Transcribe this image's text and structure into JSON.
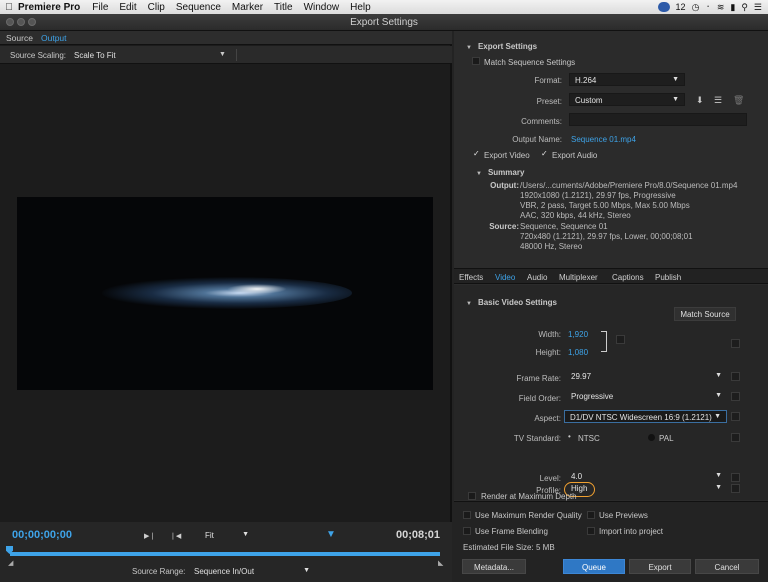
{
  "menubar": {
    "apple_icon": "apple-logo",
    "app_name": "Premiere Pro",
    "items": [
      "File",
      "Edit",
      "Clip",
      "Sequence",
      "Marker",
      "Title",
      "Window",
      "Help"
    ],
    "tray_badge_count": "12"
  },
  "window": {
    "title": "Export Settings"
  },
  "left": {
    "tabs": [
      "Source",
      "Output"
    ],
    "active_tab": "Output",
    "source_scaling_label": "Source Scaling:",
    "source_scaling_value": "Scale To Fit",
    "timecode_start": "00;00;00;00",
    "timecode_end": "00;08;01",
    "zoom_value": "Fit",
    "source_range_label": "Source Range:",
    "source_range_value": "Sequence In/Out"
  },
  "export_settings": {
    "header": "Export Settings",
    "match_sequence_label": "Match Sequence Settings",
    "format_label": "Format:",
    "format_value": "H.264",
    "preset_label": "Preset:",
    "preset_value": "Custom",
    "comments_label": "Comments:",
    "output_name_label": "Output Name:",
    "output_name_value": "Sequence 01.mp4",
    "export_video_label": "Export Video",
    "export_audio_label": "Export Audio",
    "export_video_checked": true,
    "export_audio_checked": true
  },
  "summary": {
    "header": "Summary",
    "output_label": "Output:",
    "output_lines": [
      "/Users/...cuments/Adobe/Premiere Pro/8.0/Sequence 01.mp4",
      "1920x1080 (1.2121), 29.97 fps, Progressive",
      "VBR, 2 pass, Target 5.00 Mbps, Max 5.00 Mbps",
      "AAC, 320 kbps, 44 kHz, Stereo"
    ],
    "source_label": "Source:",
    "source_lines": [
      "Sequence, Sequence 01",
      "720x480 (1.2121), 29.97 fps, Lower, 00;00;08;01",
      "48000 Hz, Stereo"
    ]
  },
  "settings_tabs": [
    "Effects",
    "Video",
    "Audio",
    "Multiplexer",
    "Captions",
    "Publish"
  ],
  "active_settings_tab": "Video",
  "video": {
    "header": "Basic Video Settings",
    "match_source_label": "Match Source",
    "width_label": "Width:",
    "width_value": "1,920",
    "height_label": "Height:",
    "height_value": "1,080",
    "frame_rate_label": "Frame Rate:",
    "frame_rate_value": "29.97",
    "field_order_label": "Field Order:",
    "field_order_value": "Progressive",
    "aspect_label": "Aspect:",
    "aspect_value": "D1/DV NTSC Widescreen 16:9 (1.2121)",
    "tv_standard_label": "TV Standard:",
    "tv_ntsc_label": "NTSC",
    "tv_pal_label": "PAL",
    "profile_label": "Profile:",
    "profile_value": "High",
    "level_label": "Level:",
    "level_value": "4.0",
    "render_max_depth_label": "Render at Maximum Depth"
  },
  "bottom": {
    "max_render_quality_label": "Use Maximum Render Quality",
    "use_previews_label": "Use Previews",
    "frame_blending_label": "Use Frame Blending",
    "import_project_label": "Import into project",
    "file_size_label": "Estimated File Size:",
    "file_size_value": "5 MB",
    "metadata_label": "Metadata...",
    "queue_label": "Queue",
    "export_label": "Export",
    "cancel_label": "Cancel"
  },
  "colors": {
    "accent": "#3ea3e8",
    "primary_button": "#2f78c5",
    "highlight_ring": "#f0a030"
  }
}
